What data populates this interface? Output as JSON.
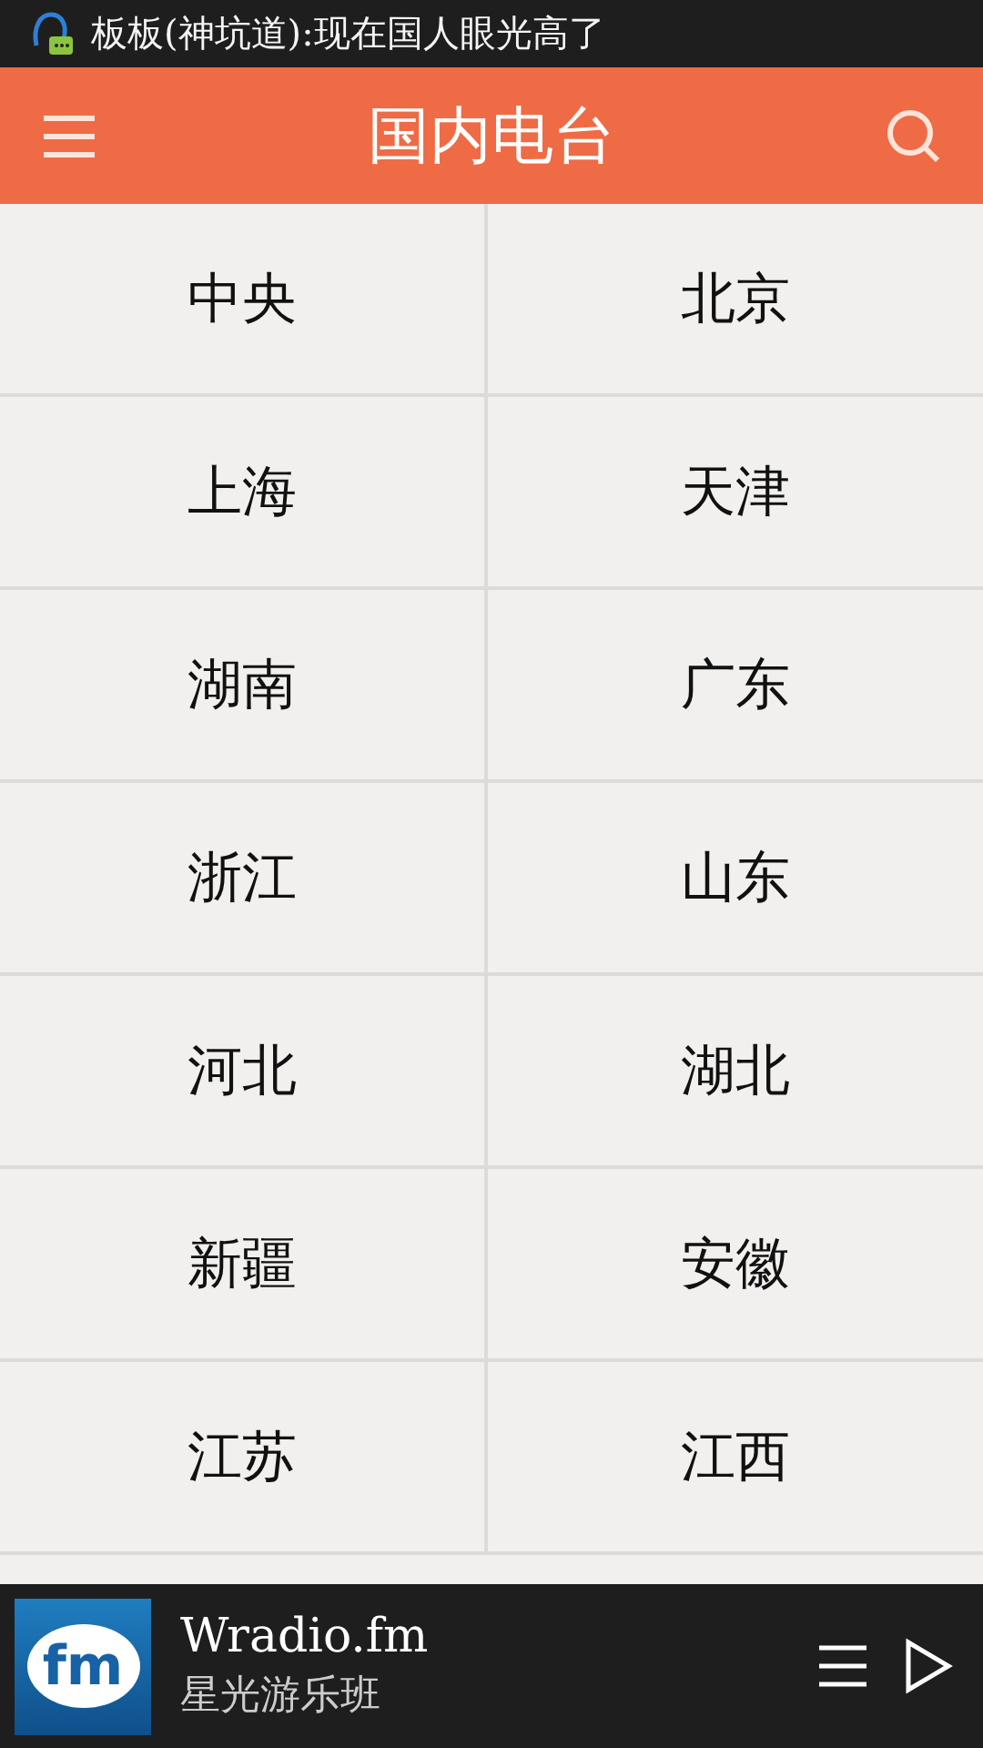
{
  "notification": {
    "text": "板板(神坑道):现在国人眼光高了"
  },
  "header": {
    "title": "国内电台"
  },
  "stations": [
    {
      "name": "中央"
    },
    {
      "name": "北京"
    },
    {
      "name": "上海"
    },
    {
      "name": "天津"
    },
    {
      "name": "湖南"
    },
    {
      "name": "广东"
    },
    {
      "name": "浙江"
    },
    {
      "name": "山东"
    },
    {
      "name": "河北"
    },
    {
      "name": "湖北"
    },
    {
      "name": "新疆"
    },
    {
      "name": "安徽"
    },
    {
      "name": "江苏"
    },
    {
      "name": "江西"
    }
  ],
  "player": {
    "logo": "fm",
    "title": "Wradio.fm",
    "subtitle": "星光游乐班"
  }
}
